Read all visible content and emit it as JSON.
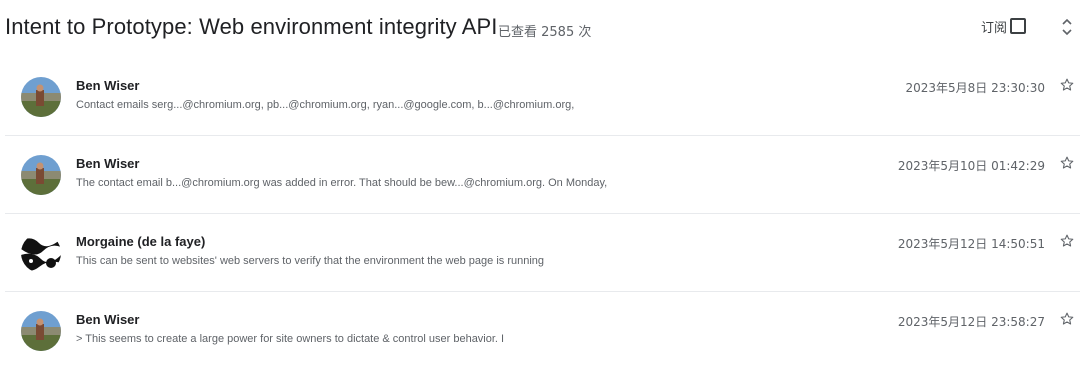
{
  "thread": {
    "title": "Intent to Prototype: Web environment integrity API",
    "views": "已查看 2585 次",
    "subscribe_label": "订阅"
  },
  "messages": [
    {
      "sender": "Ben Wiser",
      "snippet": "Contact emails serg...@chromium.org, pb...@chromium.org, ryan...@google.com, b...@chromium.org,",
      "date": "2023年5月8日 23:30:30",
      "avatar": "landscape-photo"
    },
    {
      "sender": "Ben Wiser",
      "snippet": "The contact email b...@chromium.org was added in error. That should be bew...@chromium.org. On Monday,",
      "date": "2023年5月10日 01:42:29",
      "avatar": "landscape-photo"
    },
    {
      "sender": "Morgaine (de la faye)",
      "snippet": "This can be sent to websites' web servers to verify that the environment the web page is running",
      "date": "2023年5月12日 14:50:51",
      "avatar": "black-white-pattern"
    },
    {
      "sender": "Ben Wiser",
      "snippet": "> This seems to create a large power for site owners to dictate & control user behavior. I",
      "date": "2023年5月12日 23:58:27",
      "avatar": "landscape-photo"
    }
  ]
}
